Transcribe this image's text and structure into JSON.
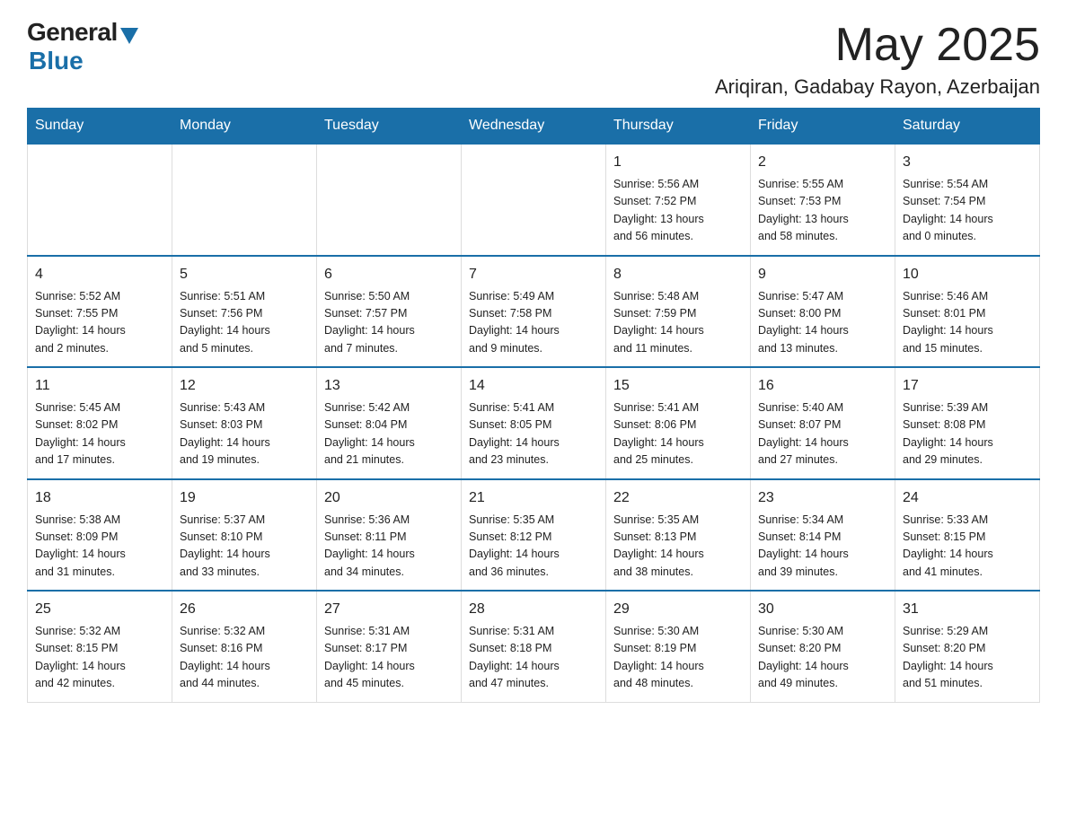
{
  "header": {
    "logo_general": "General",
    "logo_blue": "Blue",
    "month": "May 2025",
    "location": "Ariqiran, Gadabay Rayon, Azerbaijan"
  },
  "days_of_week": [
    "Sunday",
    "Monday",
    "Tuesday",
    "Wednesday",
    "Thursday",
    "Friday",
    "Saturday"
  ],
  "weeks": [
    [
      {
        "day": "",
        "info": ""
      },
      {
        "day": "",
        "info": ""
      },
      {
        "day": "",
        "info": ""
      },
      {
        "day": "",
        "info": ""
      },
      {
        "day": "1",
        "info": "Sunrise: 5:56 AM\nSunset: 7:52 PM\nDaylight: 13 hours\nand 56 minutes."
      },
      {
        "day": "2",
        "info": "Sunrise: 5:55 AM\nSunset: 7:53 PM\nDaylight: 13 hours\nand 58 minutes."
      },
      {
        "day": "3",
        "info": "Sunrise: 5:54 AM\nSunset: 7:54 PM\nDaylight: 14 hours\nand 0 minutes."
      }
    ],
    [
      {
        "day": "4",
        "info": "Sunrise: 5:52 AM\nSunset: 7:55 PM\nDaylight: 14 hours\nand 2 minutes."
      },
      {
        "day": "5",
        "info": "Sunrise: 5:51 AM\nSunset: 7:56 PM\nDaylight: 14 hours\nand 5 minutes."
      },
      {
        "day": "6",
        "info": "Sunrise: 5:50 AM\nSunset: 7:57 PM\nDaylight: 14 hours\nand 7 minutes."
      },
      {
        "day": "7",
        "info": "Sunrise: 5:49 AM\nSunset: 7:58 PM\nDaylight: 14 hours\nand 9 minutes."
      },
      {
        "day": "8",
        "info": "Sunrise: 5:48 AM\nSunset: 7:59 PM\nDaylight: 14 hours\nand 11 minutes."
      },
      {
        "day": "9",
        "info": "Sunrise: 5:47 AM\nSunset: 8:00 PM\nDaylight: 14 hours\nand 13 minutes."
      },
      {
        "day": "10",
        "info": "Sunrise: 5:46 AM\nSunset: 8:01 PM\nDaylight: 14 hours\nand 15 minutes."
      }
    ],
    [
      {
        "day": "11",
        "info": "Sunrise: 5:45 AM\nSunset: 8:02 PM\nDaylight: 14 hours\nand 17 minutes."
      },
      {
        "day": "12",
        "info": "Sunrise: 5:43 AM\nSunset: 8:03 PM\nDaylight: 14 hours\nand 19 minutes."
      },
      {
        "day": "13",
        "info": "Sunrise: 5:42 AM\nSunset: 8:04 PM\nDaylight: 14 hours\nand 21 minutes."
      },
      {
        "day": "14",
        "info": "Sunrise: 5:41 AM\nSunset: 8:05 PM\nDaylight: 14 hours\nand 23 minutes."
      },
      {
        "day": "15",
        "info": "Sunrise: 5:41 AM\nSunset: 8:06 PM\nDaylight: 14 hours\nand 25 minutes."
      },
      {
        "day": "16",
        "info": "Sunrise: 5:40 AM\nSunset: 8:07 PM\nDaylight: 14 hours\nand 27 minutes."
      },
      {
        "day": "17",
        "info": "Sunrise: 5:39 AM\nSunset: 8:08 PM\nDaylight: 14 hours\nand 29 minutes."
      }
    ],
    [
      {
        "day": "18",
        "info": "Sunrise: 5:38 AM\nSunset: 8:09 PM\nDaylight: 14 hours\nand 31 minutes."
      },
      {
        "day": "19",
        "info": "Sunrise: 5:37 AM\nSunset: 8:10 PM\nDaylight: 14 hours\nand 33 minutes."
      },
      {
        "day": "20",
        "info": "Sunrise: 5:36 AM\nSunset: 8:11 PM\nDaylight: 14 hours\nand 34 minutes."
      },
      {
        "day": "21",
        "info": "Sunrise: 5:35 AM\nSunset: 8:12 PM\nDaylight: 14 hours\nand 36 minutes."
      },
      {
        "day": "22",
        "info": "Sunrise: 5:35 AM\nSunset: 8:13 PM\nDaylight: 14 hours\nand 38 minutes."
      },
      {
        "day": "23",
        "info": "Sunrise: 5:34 AM\nSunset: 8:14 PM\nDaylight: 14 hours\nand 39 minutes."
      },
      {
        "day": "24",
        "info": "Sunrise: 5:33 AM\nSunset: 8:15 PM\nDaylight: 14 hours\nand 41 minutes."
      }
    ],
    [
      {
        "day": "25",
        "info": "Sunrise: 5:32 AM\nSunset: 8:15 PM\nDaylight: 14 hours\nand 42 minutes."
      },
      {
        "day": "26",
        "info": "Sunrise: 5:32 AM\nSunset: 8:16 PM\nDaylight: 14 hours\nand 44 minutes."
      },
      {
        "day": "27",
        "info": "Sunrise: 5:31 AM\nSunset: 8:17 PM\nDaylight: 14 hours\nand 45 minutes."
      },
      {
        "day": "28",
        "info": "Sunrise: 5:31 AM\nSunset: 8:18 PM\nDaylight: 14 hours\nand 47 minutes."
      },
      {
        "day": "29",
        "info": "Sunrise: 5:30 AM\nSunset: 8:19 PM\nDaylight: 14 hours\nand 48 minutes."
      },
      {
        "day": "30",
        "info": "Sunrise: 5:30 AM\nSunset: 8:20 PM\nDaylight: 14 hours\nand 49 minutes."
      },
      {
        "day": "31",
        "info": "Sunrise: 5:29 AM\nSunset: 8:20 PM\nDaylight: 14 hours\nand 51 minutes."
      }
    ]
  ]
}
